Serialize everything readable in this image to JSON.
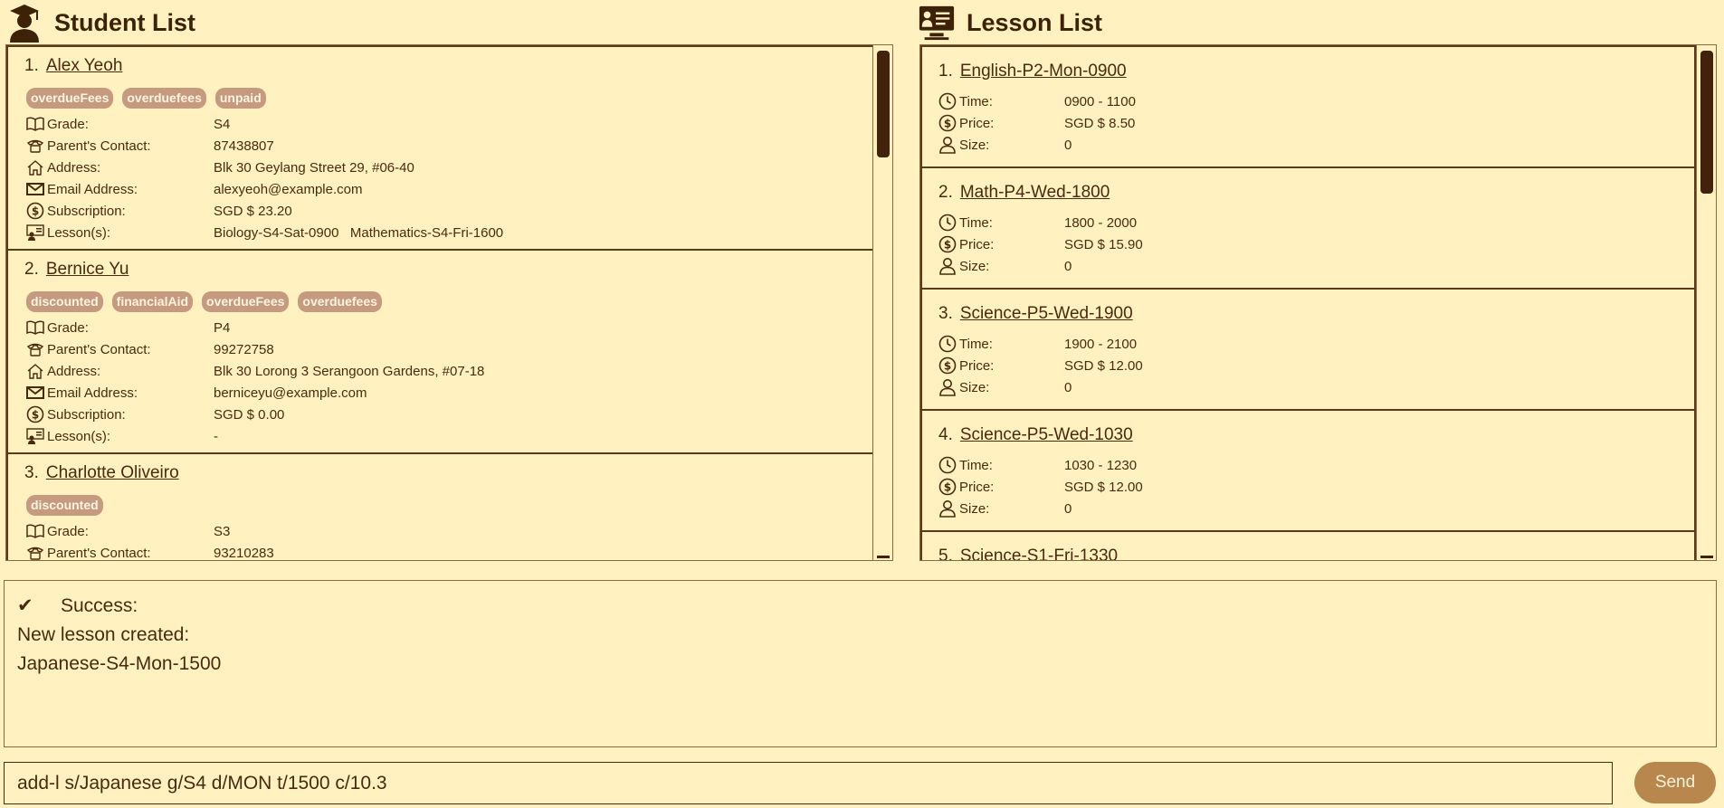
{
  "student_panel": {
    "title": "Student List",
    "students": [
      {
        "index": "1.",
        "name": "Alex Yeoh",
        "tags": [
          "overdueFees",
          "overduefees",
          "unpaid"
        ],
        "fields": [
          {
            "icon": "book-icon",
            "label": "Grade:",
            "value": "S4"
          },
          {
            "icon": "phone-icon",
            "label": "Parent's Contact:",
            "value": "87438807"
          },
          {
            "icon": "home-icon",
            "label": "Address:",
            "value": "Blk 30 Geylang Street 29, #06-40"
          },
          {
            "icon": "envelope-icon",
            "label": "Email Address:",
            "value": "alexyeoh@example.com"
          },
          {
            "icon": "dollar-icon",
            "label": "Subscription:",
            "value": "SGD $ 23.20"
          },
          {
            "icon": "lesson-icon",
            "label": "Lesson(s):",
            "value": "Biology-S4-Sat-0900   Mathematics-S4-Fri-1600"
          }
        ]
      },
      {
        "index": "2.",
        "name": "Bernice Yu",
        "tags": [
          "discounted",
          "financialAid",
          "overdueFees",
          "overduefees"
        ],
        "fields": [
          {
            "icon": "book-icon",
            "label": "Grade:",
            "value": "P4"
          },
          {
            "icon": "phone-icon",
            "label": "Parent's Contact:",
            "value": "99272758"
          },
          {
            "icon": "home-icon",
            "label": "Address:",
            "value": "Blk 30 Lorong 3 Serangoon Gardens, #07-18"
          },
          {
            "icon": "envelope-icon",
            "label": "Email Address:",
            "value": "berniceyu@example.com"
          },
          {
            "icon": "dollar-icon",
            "label": "Subscription:",
            "value": "SGD $ 0.00"
          },
          {
            "icon": "lesson-icon",
            "label": "Lesson(s):",
            "value": "-"
          }
        ]
      },
      {
        "index": "3.",
        "name": "Charlotte Oliveiro",
        "tags": [
          "discounted"
        ],
        "fields": [
          {
            "icon": "book-icon",
            "label": "Grade:",
            "value": "S3"
          },
          {
            "icon": "phone-icon",
            "label": "Parent's Contact:",
            "value": "93210283"
          }
        ]
      }
    ]
  },
  "lesson_panel": {
    "title": "Lesson List",
    "lessons": [
      {
        "index": "1.",
        "name": "English-P2-Mon-0900",
        "time": "0900 - 1100",
        "price": "SGD $ 8.50",
        "size": "0"
      },
      {
        "index": "2.",
        "name": "Math-P4-Wed-1800",
        "time": "1800 - 2000",
        "price": "SGD $ 15.90",
        "size": "0"
      },
      {
        "index": "3.",
        "name": "Science-P5-Wed-1900",
        "time": "1900 - 2100",
        "price": "SGD $ 12.00",
        "size": "0"
      },
      {
        "index": "4.",
        "name": "Science-P5-Wed-1030",
        "time": "1030 - 1230",
        "price": "SGD $ 12.00",
        "size": "0"
      },
      {
        "index": "5.",
        "name": "Science-S1-Fri-1330"
      }
    ],
    "labels": {
      "time": "Time:",
      "price": "Price:",
      "size": "Size:"
    }
  },
  "result": {
    "check": "✔",
    "status": "Success:",
    "line1": "New lesson created:",
    "line2": "Japanese-S4-Mon-1500"
  },
  "command": {
    "value": "add-l s/Japanese g/S4 d/MON t/1500 c/10.3",
    "send_label": "Send"
  }
}
